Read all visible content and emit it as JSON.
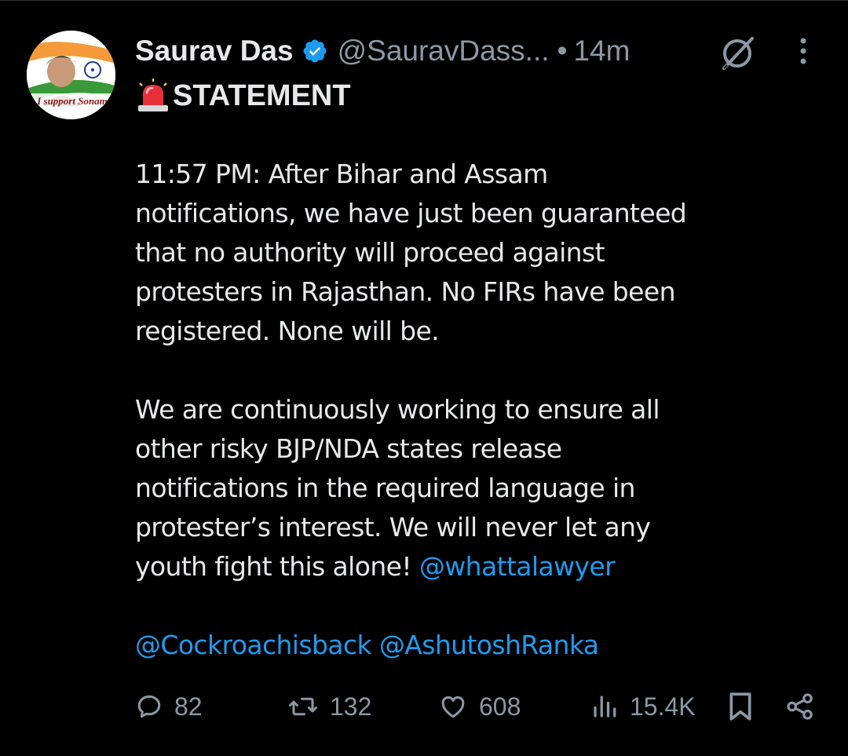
{
  "tweet": {
    "author": {
      "display_name": "Saurav Das",
      "handle": "@SauravDass...",
      "avatar_caption": "I support Sonam",
      "verified": true
    },
    "separator": "•",
    "time": "14m",
    "title": "STATEMENT",
    "title_emoji": "police-siren-icon",
    "body": {
      "para1": [
        "11:57 PM: After Bihar and Assam",
        "notifications, we have just been guaranteed",
        "that no authority will proceed against",
        "protesters in Rajasthan. No FIRs have been",
        "registered. None will be."
      ],
      "para2": [
        "We are continuously working to ensure all",
        "other risky BJP/NDA states release",
        "notifications in the required language in",
        "protester’s interest. We will never let any"
      ],
      "para2_last_text": "youth fight this alone! ",
      "para2_last_mention": "@whattalawyer",
      "mention_1": "@Cockroachisback",
      "mention_2": "@AshutoshRanka"
    },
    "metrics": {
      "replies": "82",
      "reposts": "132",
      "likes": "608",
      "views": "15.4K"
    }
  },
  "colors": {
    "background": "#000000",
    "text": "#e7e9ea",
    "secondary": "#8b98a5",
    "accent": "#1d9bf0"
  },
  "icons": [
    "grok-icon",
    "more-icon",
    "reply-icon",
    "repost-icon",
    "like-icon",
    "views-icon",
    "bookmark-icon",
    "share-icon",
    "verified-badge-icon"
  ]
}
